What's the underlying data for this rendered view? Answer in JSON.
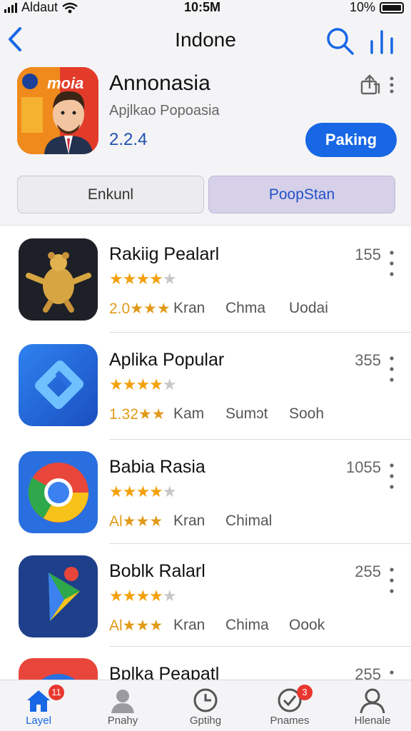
{
  "status_bar": {
    "carrier": "Aldaut",
    "time": "10:5M",
    "battery": "10%"
  },
  "nav": {
    "title": "Indone"
  },
  "hero": {
    "icon_text": "moia",
    "title": "Annonasia",
    "subtitle": "Apjlkao Popoasia",
    "rating": "2.2.4",
    "get_label": "Paking"
  },
  "segments": [
    {
      "label": "Enkunl",
      "selected": false
    },
    {
      "label": "PoopStan",
      "selected": true
    }
  ],
  "apps": [
    {
      "name": "Rakiig Pealarl",
      "stars": 4,
      "count": "155",
      "meta": [
        "2.0★★★",
        "Kran",
        "Chma",
        "Uodai"
      ]
    },
    {
      "name": "Aplika Popular",
      "stars": 4,
      "count": "355",
      "meta": [
        "1.32★★",
        "Kam",
        "Sumɔt",
        "Sooh"
      ]
    },
    {
      "name": "Babia Rasia",
      "stars": 4,
      "count": "1055",
      "meta": [
        "Al★★★",
        "Kran",
        "Chimal",
        ""
      ]
    },
    {
      "name": "Boblk Ralarl",
      "stars": 3.5,
      "count": "255",
      "meta": [
        "Al★★★",
        "Kran",
        "Chima",
        "Oook"
      ]
    },
    {
      "name": "Bplka Peapatl",
      "stars": 0,
      "count": "255",
      "meta": [
        "",
        "",
        "",
        ""
      ]
    }
  ],
  "tabs": [
    {
      "label": "Layel",
      "icon": "home-icon",
      "badge": "11",
      "active": true
    },
    {
      "label": "Pnahy",
      "icon": "person-icon",
      "badge": "",
      "active": false
    },
    {
      "label": "Gptihg",
      "icon": "clock-icon",
      "badge": "",
      "active": false
    },
    {
      "label": "Pnames",
      "icon": "check-icon",
      "badge": "3",
      "active": false
    },
    {
      "label": "Hlenale",
      "icon": "account-icon",
      "badge": "",
      "active": false
    }
  ],
  "colors": {
    "accent": "#1867e5",
    "star": "#f3a10e",
    "badge": "#e8372e"
  }
}
